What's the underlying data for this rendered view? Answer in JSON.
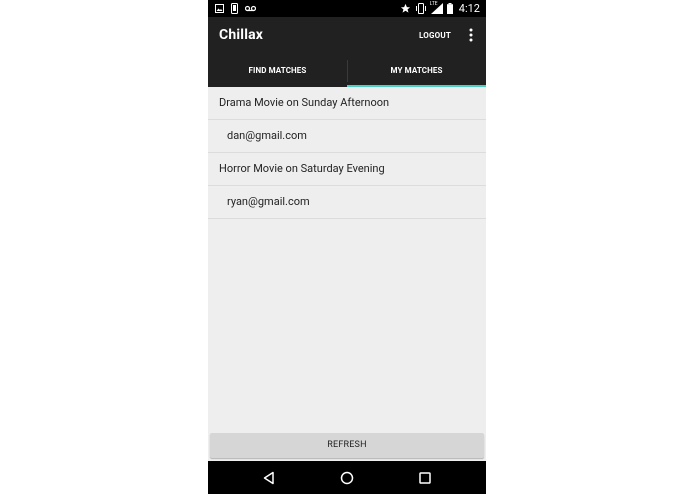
{
  "status_bar": {
    "time": "4:12",
    "icons_left": [
      "image-icon",
      "phone-portrait-icon",
      "voicemail-icon"
    ],
    "icons_right": [
      "star-icon",
      "vibrate-icon",
      "signal-lte-icon",
      "battery-icon"
    ],
    "network_label": "LTE"
  },
  "app_bar": {
    "title": "Chillax",
    "logout_label": "LOGOUT",
    "overflow_icon": "more-vert-icon"
  },
  "tabs": [
    {
      "label": "FIND MATCHES",
      "selected": false
    },
    {
      "label": "MY MATCHES",
      "selected": true
    }
  ],
  "accent_color": "#4dd0c0",
  "matches": [
    {
      "title": "Drama Movie on Sunday Afternoon",
      "email": "dan@gmail.com"
    },
    {
      "title": "Horror Movie on Saturday Evening",
      "email": "ryan@gmail.com"
    }
  ],
  "refresh_label": "REFRESH",
  "nav_bar": {
    "icons": [
      "back-icon",
      "home-icon",
      "recents-icon"
    ]
  }
}
